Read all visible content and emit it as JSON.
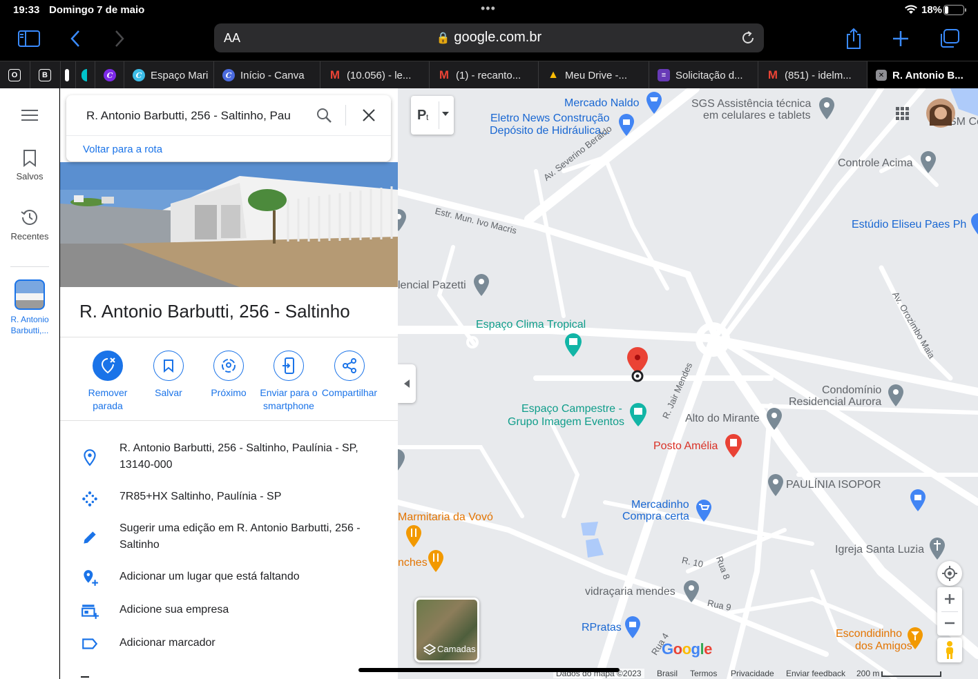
{
  "status": {
    "time": "19:33",
    "date": "Domingo 7 de maio",
    "battery": "18%"
  },
  "browser": {
    "aa_label": "AA",
    "url": "google.com.br",
    "tabs": [
      {
        "label": "",
        "fav": "O"
      },
      {
        "label": "",
        "fav": "B"
      },
      {
        "label": "",
        "fav": ""
      },
      {
        "label": "",
        "fav": "C"
      },
      {
        "label": "",
        "fav": "C"
      },
      {
        "label": "Espaço Mari",
        "fav": "C"
      },
      {
        "label": "Início - Canva",
        "fav": "C"
      },
      {
        "label": "(10.056) - le...",
        "fav": "M"
      },
      {
        "label": "(1) - recanto...",
        "fav": "M"
      },
      {
        "label": "Meu Drive -...",
        "fav": "▲"
      },
      {
        "label": "Solicitação d...",
        "fav": "≡"
      },
      {
        "label": "(851) - idelm...",
        "fav": "M"
      },
      {
        "label": "R. Antonio B...",
        "fav": "✕"
      }
    ]
  },
  "rail": {
    "saved": "Salvos",
    "recent": "Recentes",
    "place_thumb_label": "R. Antonio Barbutti,..."
  },
  "panel": {
    "search_query": "R. Antonio Barbutti, 256 - Saltinho, Pau",
    "back_to_route": "Voltar para a rota",
    "title": "R. Antonio Barbutti, 256 - Saltinho",
    "actions": [
      {
        "label": "Remover parada",
        "icon": "remove-stop-icon"
      },
      {
        "label": "Salvar",
        "icon": "bookmark-icon"
      },
      {
        "label": "Próximo",
        "icon": "nearby-icon"
      },
      {
        "label": "Enviar para o smartphone",
        "icon": "send-to-phone-icon"
      },
      {
        "label": "Compartilhar",
        "icon": "share-icon"
      }
    ],
    "info": [
      {
        "text": "R. Antonio Barbutti, 256 - Saltinho, Paulínia - SP, 13140-000",
        "icon": "location-pin-icon"
      },
      {
        "text": "7R85+HX Saltinho, Paulínia - SP",
        "icon": "plus-code-icon"
      },
      {
        "text": "Sugerir uma edição em R. Antonio Barbutti, 256 - Saltinho",
        "icon": "pencil-icon"
      },
      {
        "text": "Adicionar um lugar que está faltando",
        "icon": "add-place-icon"
      },
      {
        "text": "Adicione sua empresa",
        "icon": "add-business-icon"
      },
      {
        "text": "Adicionar marcador",
        "icon": "label-icon"
      }
    ]
  },
  "map": {
    "labels": [
      {
        "text": "Mercado Naldo",
        "color": "blue"
      },
      {
        "text": "Eletro News Construção",
        "color": "blue"
      },
      {
        "text": "Depósito de Hidráulica...",
        "color": "blue"
      },
      {
        "text": "SGS Assistência técnica",
        "color": "gray"
      },
      {
        "text": "em celulares e tablets",
        "color": "gray"
      },
      {
        "text": "Controle Acima",
        "color": "gray"
      },
      {
        "text": "Estúdio Eliseu Paes Ph",
        "color": "blue"
      },
      {
        "text": "lencial Pazetti",
        "color": "gray"
      },
      {
        "text": "Espaço Clima Tropical",
        "color": "teal"
      },
      {
        "text": "Espaço Campestre -",
        "color": "teal"
      },
      {
        "text": "Grupo Imagem Eventos",
        "color": "teal"
      },
      {
        "text": "Condomínio",
        "color": "gray"
      },
      {
        "text": "Residencial Aurora",
        "color": "gray"
      },
      {
        "text": "Alto do Mirante",
        "color": "gray"
      },
      {
        "text": "Posto Amélia",
        "color": "red"
      },
      {
        "text": "PAULÍNIA ISOPOR",
        "color": "gray"
      },
      {
        "text": "Mercadinho",
        "color": "blue"
      },
      {
        "text": "Compra certa",
        "color": "blue"
      },
      {
        "text": "Marmitaria da Vovó",
        "color": "orange"
      },
      {
        "text": "nches",
        "color": "orange"
      },
      {
        "text": "Igreja Santa Luzia",
        "color": "gray"
      },
      {
        "text": "vidraçaria mendes",
        "color": "gray"
      },
      {
        "text": "RPratas",
        "color": "blue"
      },
      {
        "text": "Escondidinho",
        "color": "orange"
      },
      {
        "text": "dos Amigos",
        "color": "orange"
      },
      {
        "text": "SM Ce",
        "color": "gray"
      }
    ],
    "roads": [
      "Av. Severino Beraldo",
      "Estr. Mun. Ivo Macris",
      "Av. Orozimbo Maia",
      "R. Jair Mendes",
      "R. 10",
      "Rua 8",
      "Rua 9",
      "Rua 4"
    ],
    "layers_label": "Camadas",
    "transit_label": "P",
    "footer": {
      "data": "Dados do mapa ©2023",
      "country": "Brasil",
      "terms": "Termos",
      "privacy": "Privacidade",
      "feedback": "Enviar feedback",
      "scale": "200 m"
    },
    "logo": "Google"
  }
}
